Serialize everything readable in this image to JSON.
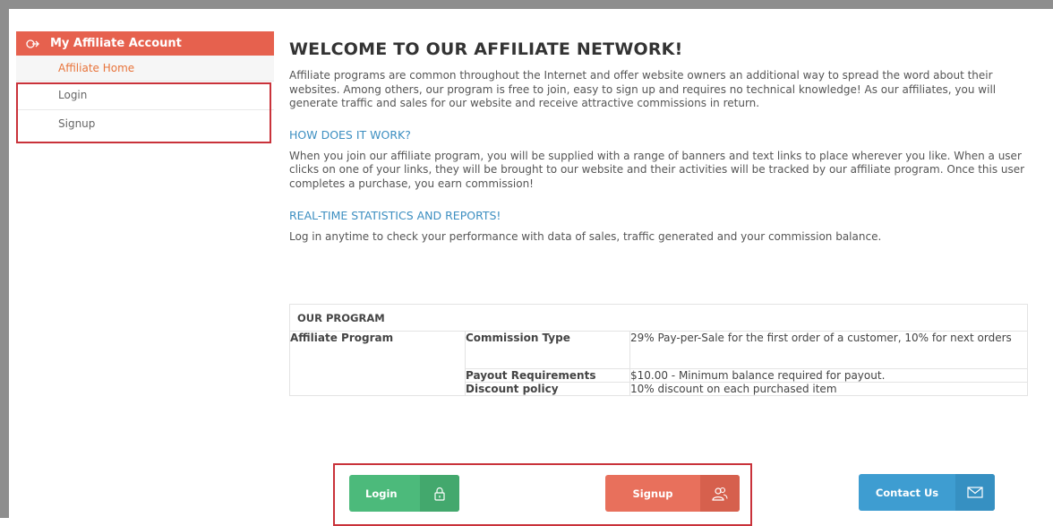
{
  "sidebar": {
    "header": "My Affiliate Account",
    "items": [
      {
        "label": "Affiliate Home"
      },
      {
        "label": "Login"
      },
      {
        "label": "Signup"
      }
    ]
  },
  "main": {
    "title": "WELCOME TO OUR AFFILIATE NETWORK!",
    "intro": "Affiliate programs are common throughout the Internet and offer website owners an additional way to spread the word about their websites. Among others, our program is free to join, easy to sign up and requires no technical knowledge! As our affiliates, you will generate traffic and sales for our website and receive attractive commissions in return.",
    "how_heading": "HOW DOES IT WORK?",
    "how_text": "When you join our affiliate program, you will be supplied with a range of banners and text links to place wherever you like. When a user clicks on one of your links, they will be brought to our website and their activities will be tracked by our affiliate program. Once this user completes a purchase, you earn commission!",
    "stats_heading": "REAL-TIME STATISTICS AND REPORTS!",
    "stats_text": "Log in anytime to check your performance with data of sales, traffic generated and your commission balance."
  },
  "program": {
    "caption": "OUR PROGRAM",
    "program_name": "Affiliate Program",
    "rows": [
      {
        "key": "Commission Type",
        "value": "29% Pay-per-Sale for the first order of a customer, 10% for next orders"
      },
      {
        "key": "Payout Requirements",
        "value": "$10.00 - Minimum balance required for payout."
      },
      {
        "key": "Discount policy",
        "value": "10% discount on each purchased item"
      }
    ]
  },
  "buttons": {
    "login": "Login",
    "signup": "Signup",
    "contact": "Contact Us"
  }
}
